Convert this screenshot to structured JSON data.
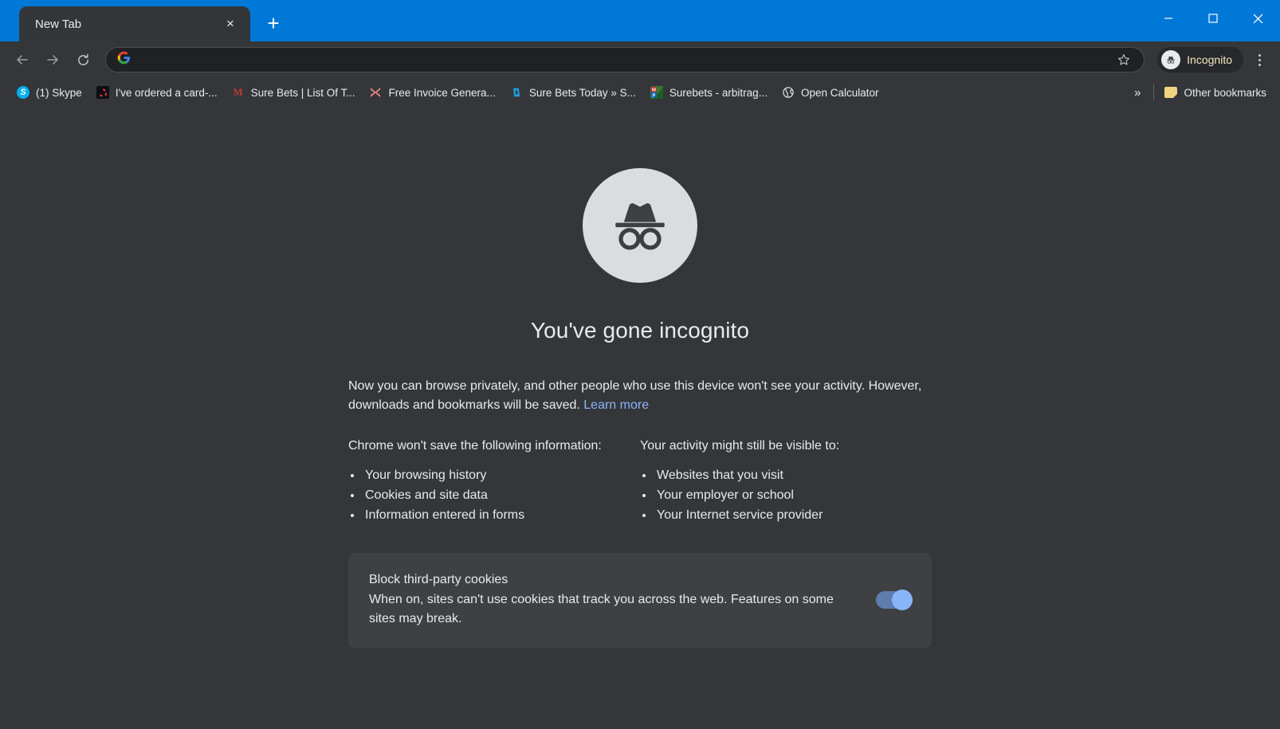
{
  "window": {
    "controls": {
      "minimize": "minimize-button",
      "maximize": "maximize-button",
      "close": "close-button"
    },
    "titlebar_color": "#0078d7"
  },
  "tabstrip": {
    "tabs": [
      {
        "title": "New Tab",
        "active": true
      }
    ],
    "new_tab_label": "+",
    "close_label": "×"
  },
  "toolbar": {
    "back": "←",
    "forward": "→",
    "reload": "⟳",
    "omnibox": {
      "value": "",
      "placeholder": "",
      "leading_icon": "google-g-icon"
    },
    "bookmark_star": "☆",
    "incognito_chip_label": "Incognito",
    "incognito_chip_text_color": "#f3e5c3",
    "menu": "kebab-menu"
  },
  "bookmarks": {
    "items": [
      {
        "label": "(1) Skype",
        "icon": "skype-icon"
      },
      {
        "label": "I've ordered a card-...",
        "icon": "card-icon"
      },
      {
        "label": "Sure Bets | List Of T...",
        "icon": "m-letter-icon"
      },
      {
        "label": "Free Invoice Genera...",
        "icon": "x-cross-icon"
      },
      {
        "label": "Sure Bets Today » S...",
        "icon": "blue-d-icon"
      },
      {
        "label": "Surebets - arbitrag...",
        "icon": "wordpress-doc-icon"
      },
      {
        "label": "Open Calculator",
        "icon": "globe-icon"
      }
    ],
    "overflow_label": "»",
    "other_bookmarks_label": "Other bookmarks"
  },
  "page": {
    "avatar_icon": "incognito-avatar-icon",
    "headline": "You've gone incognito",
    "intro_line1": "Now you can browse privately, and other people who use this device won't see your activity.",
    "intro_line2": "However, downloads and bookmarks will be saved.",
    "learn_more": "Learn more",
    "left_column": {
      "heading": "Chrome won't save the following information:",
      "items": [
        "Your browsing history",
        "Cookies and site data",
        "Information entered in forms"
      ]
    },
    "right_column": {
      "heading": "Your activity might still be visible to:",
      "items": [
        "Websites that you visit",
        "Your employer or school",
        "Your Internet service provider"
      ]
    },
    "cookie_card": {
      "title": "Block third-party cookies",
      "description": "When on, sites can't use cookies that track you across the web. Features on some sites may break.",
      "toggle_state": "on",
      "toggle_track_color": "#5f7cad",
      "toggle_knob_color": "#8ab4f8"
    },
    "background_color": "#35363a",
    "link_color": "#8ab4f8"
  }
}
